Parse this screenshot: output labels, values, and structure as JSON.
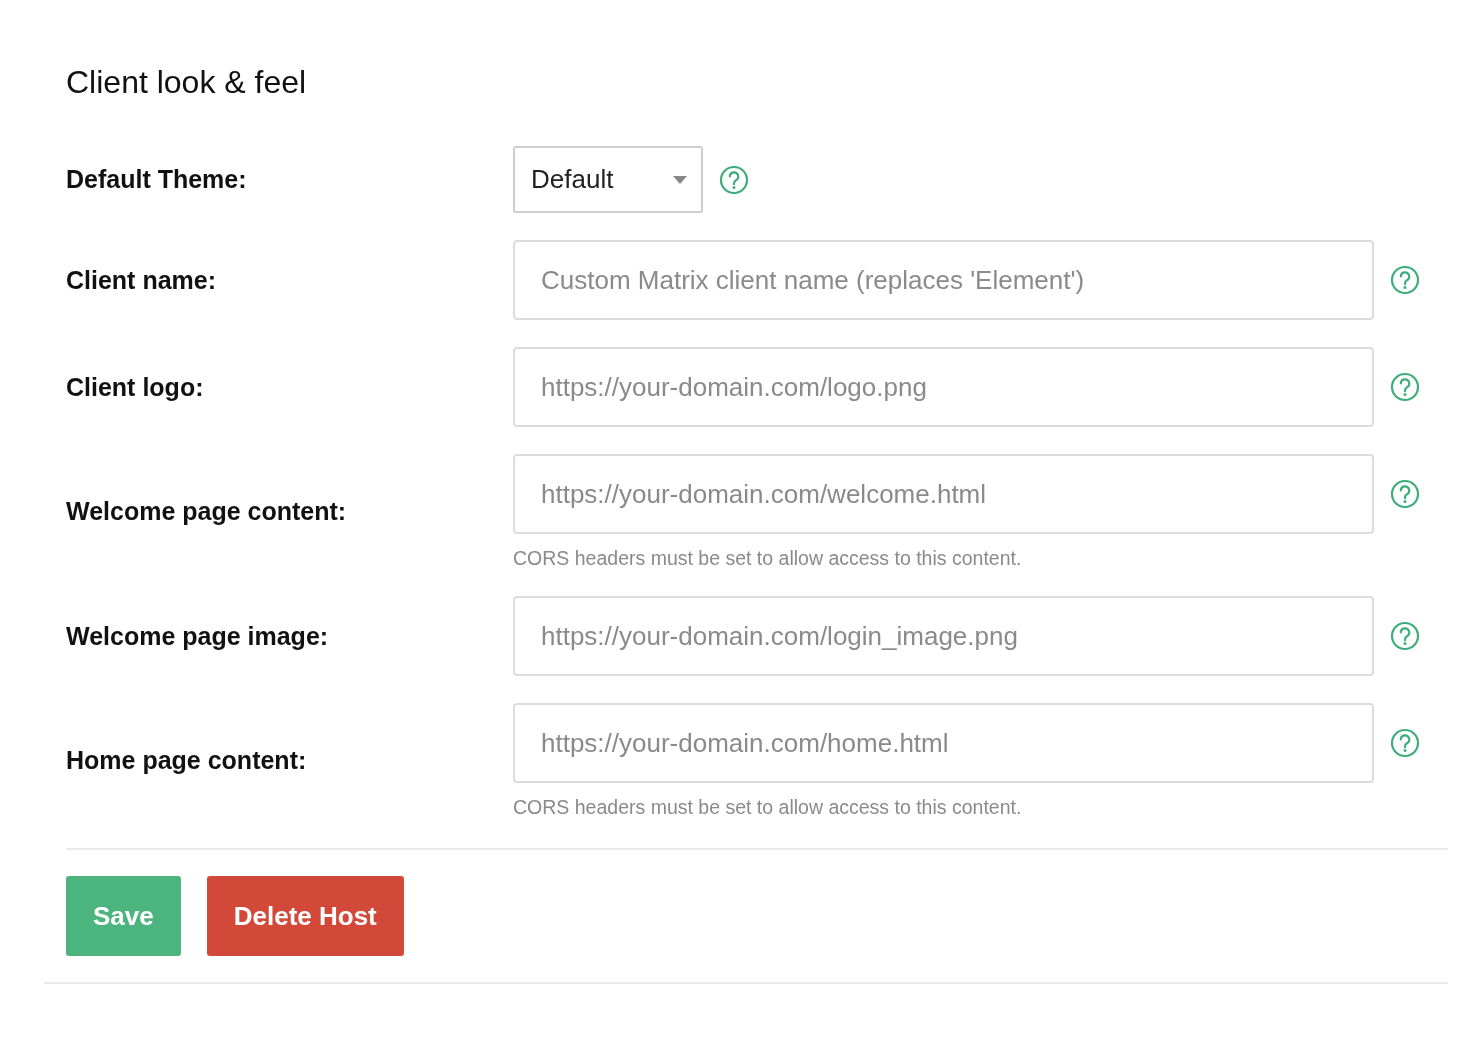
{
  "section_title": "Client look & feel",
  "fields": [
    {
      "kind": "select",
      "label": "Default Theme:",
      "value": "Default"
    },
    {
      "kind": "text",
      "label": "Client name:",
      "placeholder": "Custom Matrix client name (replaces 'Element')"
    },
    {
      "kind": "text",
      "label": "Client logo:",
      "placeholder": "https://your-domain.com/logo.png"
    },
    {
      "kind": "text",
      "label": "Welcome page content:",
      "placeholder": "https://your-domain.com/welcome.html",
      "hint": "CORS headers must be set to allow access to this content."
    },
    {
      "kind": "text",
      "label": "Welcome page image:",
      "placeholder": "https://your-domain.com/login_image.png"
    },
    {
      "kind": "text",
      "label": "Home page content:",
      "placeholder": "https://your-domain.com/home.html",
      "hint": "CORS headers must be set to allow access to this content."
    }
  ],
  "buttons": [
    {
      "kind": "primary",
      "label": "Save"
    },
    {
      "kind": "danger",
      "label": "Delete Host"
    }
  ]
}
